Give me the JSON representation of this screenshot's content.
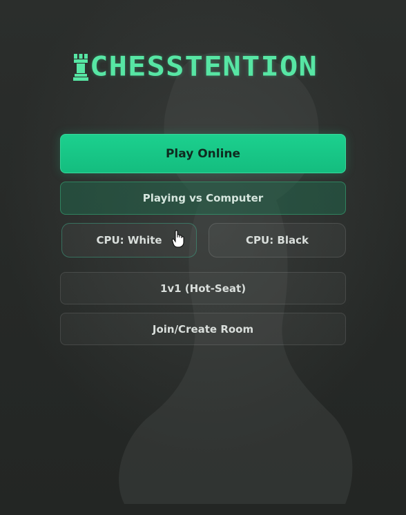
{
  "app": {
    "logo_text": "CHESSTENTION",
    "logo_icon": "rook-icon"
  },
  "menu": {
    "play_online": "Play Online",
    "mode_status": "Playing vs Computer",
    "cpu_white": "CPU: White",
    "cpu_black": "CPU: Black",
    "hot_seat": "1v1 (Hot-Seat)",
    "join_room": "Join/Create Room"
  },
  "colors": {
    "accent": "#1cd08e",
    "logo": "#57e6a4",
    "background": "#262927"
  }
}
